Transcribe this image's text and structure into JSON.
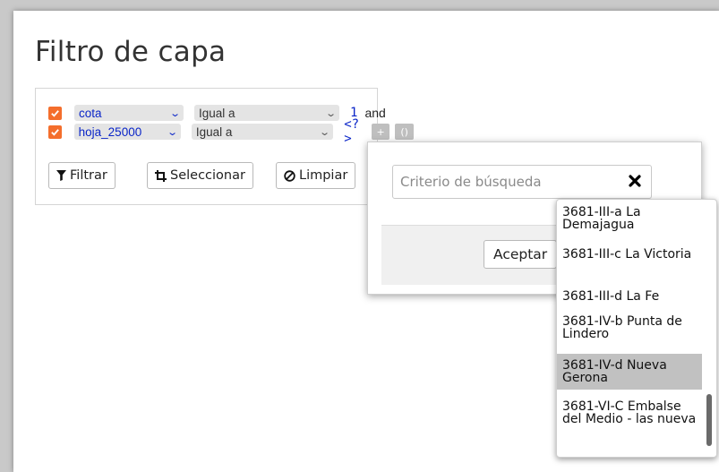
{
  "page": {
    "title": "Filtro de capa"
  },
  "filters": [
    {
      "checked": true,
      "field": "cota",
      "operator": "Igual a",
      "value": "1",
      "connector": "and"
    },
    {
      "checked": true,
      "field": "hoja_25000",
      "operator": "Igual a",
      "value": "<?>",
      "add_label": "+",
      "group_label": "()"
    }
  ],
  "actions": {
    "filter_label": "Filtrar",
    "select_label": "Seleccionar",
    "clear_label": "Limpiar"
  },
  "popup": {
    "search_placeholder": "Criterio de búsqueda",
    "search_value": "",
    "accept_label": "Aceptar"
  },
  "dropdown": {
    "options": [
      "3681-III-a La Demajagua",
      "3681-III-c La Victoria",
      "3681-III-d La Fe",
      "3681-IV-b Punta de Lindero",
      "3681-IV-d Nueva Gerona",
      "3681-VI-C Embalse del Medio - las nueva"
    ],
    "selected_index": 4
  },
  "colors": {
    "checkbox": "#f46e2c",
    "field_text": "#0a25c8",
    "selected_option": "#c1c1c1"
  },
  "icons": {
    "filter": "funnel-icon",
    "select": "crop-icon",
    "clear": "ban-icon",
    "close": "close-icon"
  }
}
